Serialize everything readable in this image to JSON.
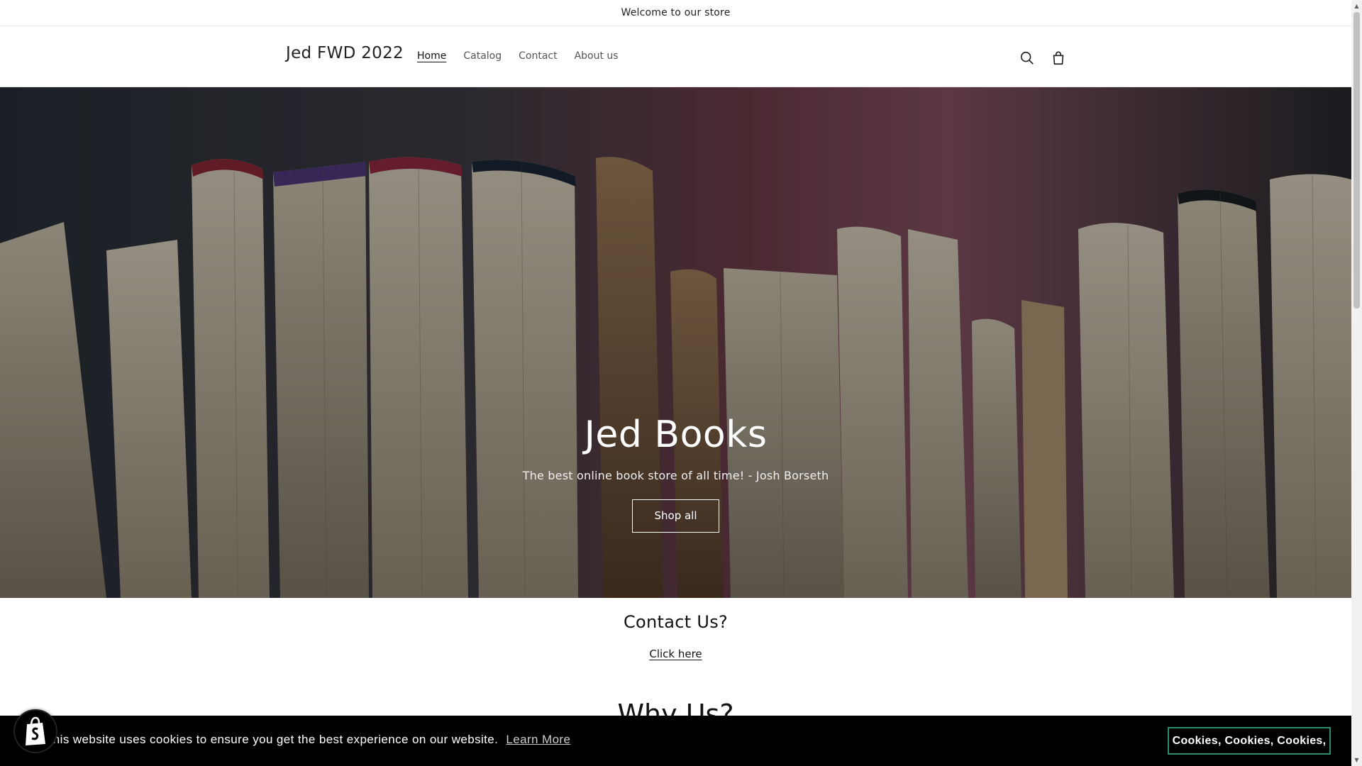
{
  "announcement": {
    "text": "Welcome to our store"
  },
  "header": {
    "logo": "Jed FWD 2022",
    "nav": [
      {
        "label": "Home",
        "active": true
      },
      {
        "label": "Catalog",
        "active": false
      },
      {
        "label": "Contact",
        "active": false
      },
      {
        "label": "About us",
        "active": false
      }
    ],
    "icons": {
      "search": "search-icon",
      "cart": "cart-icon"
    }
  },
  "hero": {
    "title": "Jed Books",
    "subtitle": "The best online book store of all time! - Josh Borseth",
    "button": "Shop all"
  },
  "contact": {
    "title": "Contact Us?",
    "link": "Click here"
  },
  "why": {
    "title": "Why Us?"
  },
  "cookie": {
    "message": "This website uses cookies to ensure you get the best experience on our website.",
    "learn_more": "Learn More",
    "accept": "Cookies, Cookies, Cookies,"
  },
  "colors": {
    "accent_border": "#2a8e6e",
    "cookie_bg": "#000000",
    "text": "#121212"
  },
  "shopify_badge": {
    "icon": "shopify-bag-icon"
  }
}
